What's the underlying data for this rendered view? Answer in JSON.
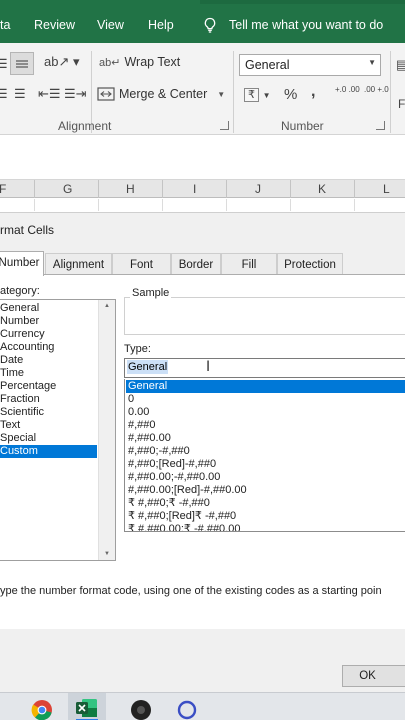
{
  "ribbon_tabs": [
    "ta",
    "Review",
    "View",
    "Help"
  ],
  "tell_me": "Tell me what you want to do",
  "ribbon": {
    "wrap_text": "Wrap Text",
    "merge_center": "Merge & Center",
    "alignment_group": "Alignment",
    "number_format_value": "General",
    "number_group": "Number",
    "percent_symbol": "%",
    "comma_symbol": ",",
    "increase_decimal": "+.0 .00",
    "decrease_decimal": ".00 +.0",
    "currency_symbol": "₹",
    "edge_letter": "F"
  },
  "columns": [
    "F",
    "G",
    "H",
    "I",
    "J",
    "K",
    "L"
  ],
  "dialog": {
    "title": "rmat Cells",
    "tabs": [
      "Number",
      "Alignment",
      "Font",
      "Border",
      "Fill",
      "Protection"
    ],
    "active_tab": "Number",
    "category_label": "ategory:",
    "categories": [
      "General",
      "Number",
      "Currency",
      "Accounting",
      "Date",
      "Time",
      "Percentage",
      "Fraction",
      "Scientific",
      "Text",
      "Special",
      "Custom"
    ],
    "selected_category": "Custom",
    "sample_label": "Sample",
    "type_label": "Type:",
    "type_value": "General",
    "formats": [
      "General",
      "0",
      "0.00",
      "#,##0",
      "#,##0.00",
      "#,##0;-#,##0",
      "#,##0;[Red]-#,##0",
      "#,##0.00;-#,##0.00",
      "#,##0.00;[Red]-#,##0.00",
      "₹ #,##0;₹ -#,##0",
      "₹ #,##0;[Red]₹ -#,##0",
      "₹ #,##0.00;₹ -#,##0.00"
    ],
    "selected_format": "General",
    "hint": "ype the number format code, using one of the existing codes as a starting poin",
    "ok_label": "OK"
  },
  "colors": {
    "ribbon_green": "#217346",
    "selection_blue": "#0078d7"
  },
  "taskbar_apps": [
    "chrome-icon",
    "excel-icon",
    "media-icon",
    "search-app-icon"
  ]
}
